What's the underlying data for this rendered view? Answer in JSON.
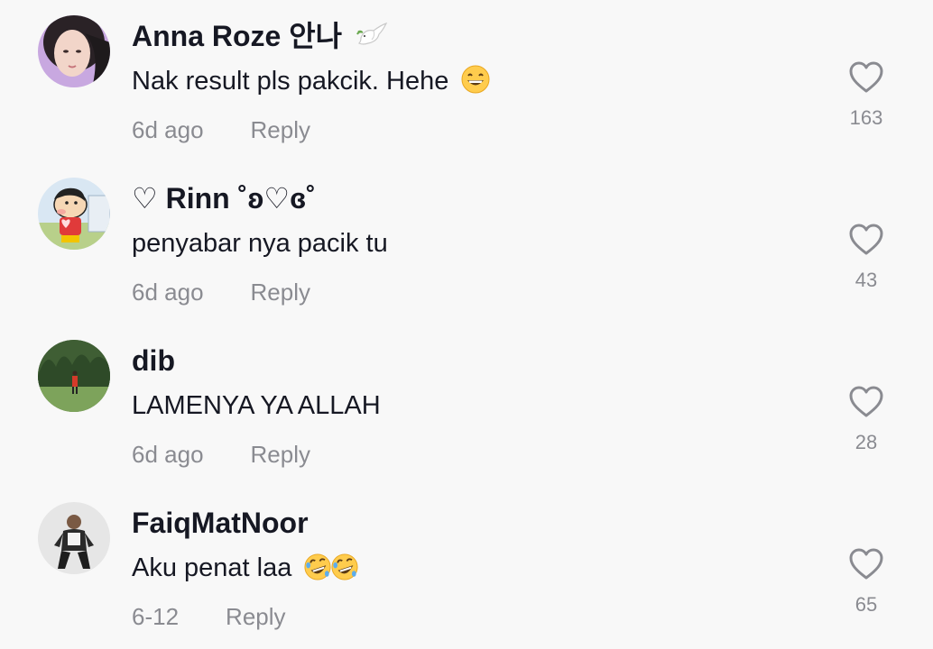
{
  "comments": [
    {
      "username": "Anna Roze 안나",
      "username_icon": "dove-icon",
      "text": "Nak result pls pakcik. Hehe",
      "text_icons": [
        "grinning-emoji"
      ],
      "time": "6d ago",
      "reply_label": "Reply",
      "likes": "163"
    },
    {
      "username": "♡ Rinn ˚ʚ♡ɞ˚",
      "text": "penyabar nya pacik tu",
      "time": "6d ago",
      "reply_label": "Reply",
      "likes": "43"
    },
    {
      "username": "dib",
      "text": "LAMENYA YA ALLAH",
      "time": "6d ago",
      "reply_label": "Reply",
      "likes": "28"
    },
    {
      "username": "FaiqMatNoor",
      "text": "Aku penat laa",
      "text_icons": [
        "rofl-emoji",
        "rofl-emoji"
      ],
      "time": "6-12",
      "reply_label": "Reply",
      "likes": "65"
    }
  ],
  "colors": {
    "background": "#f8f8f8",
    "primary_text": "#161823",
    "secondary_text": "#8a8b91",
    "heart_outline": "#8a8b91"
  }
}
